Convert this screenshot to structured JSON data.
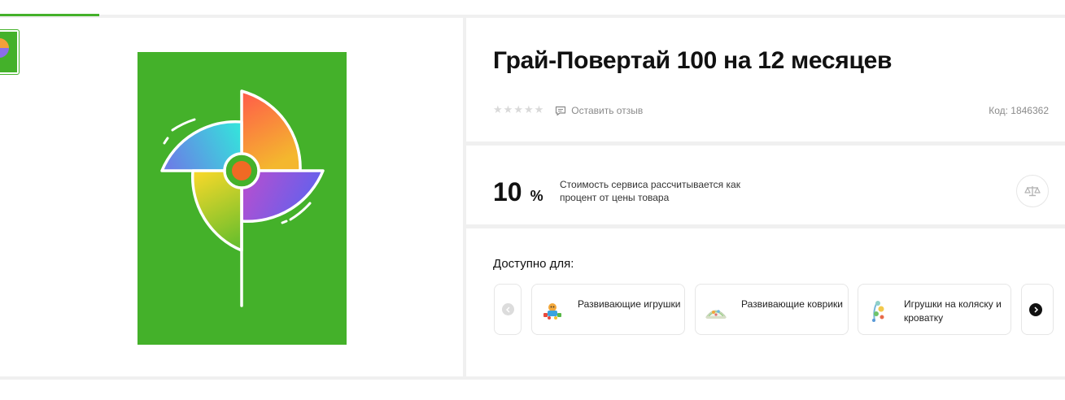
{
  "product": {
    "title": "Грай-Повертай 100 на 12 месяцев",
    "rating_stars": 0,
    "review_link": "Оставить отзыв",
    "code": "Код: 1846362"
  },
  "service": {
    "percent_value": "10",
    "percent_sign": "%",
    "note": "Стоимость сервиса рассчитывается как процент от цены товара"
  },
  "availability": {
    "label": "Доступно для:",
    "categories": [
      {
        "label": "Развивающие игрушки",
        "icon": "developing-toys-icon"
      },
      {
        "label": "Развивающие коврики",
        "icon": "play-mat-icon"
      },
      {
        "label": "Игрушки на коляску и кроватку",
        "icon": "stroller-toy-icon"
      }
    ]
  },
  "colors": {
    "brand_green": "#44b12a",
    "accent_orange": "#f06a24"
  },
  "icons": {
    "compare": "scales-icon",
    "prev": "chevron-left-icon",
    "next": "chevron-right-icon",
    "review": "comment-icon"
  }
}
